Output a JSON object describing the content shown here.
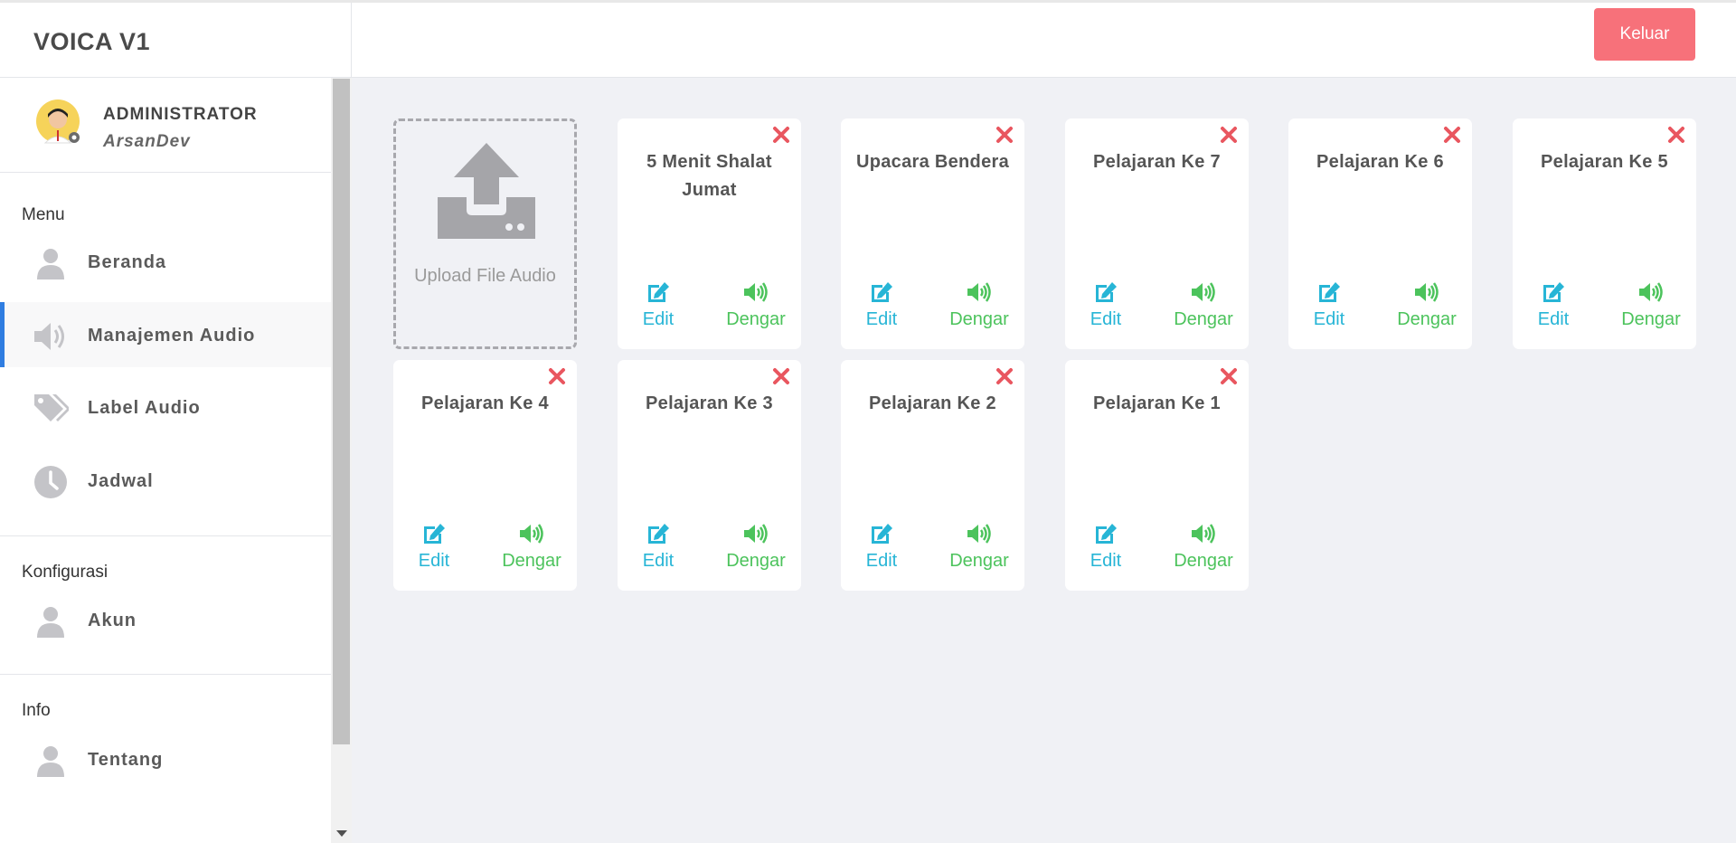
{
  "app": {
    "brand": "VOICA V1",
    "logout_label": "Keluar"
  },
  "profile": {
    "role": "ADMINISTRATOR",
    "username": "ArsanDev"
  },
  "sidebar": {
    "sections": [
      {
        "title": "Menu",
        "items": [
          {
            "label": "Beranda",
            "icon": "user-icon"
          },
          {
            "label": "Manajemen Audio",
            "icon": "volume-icon",
            "active": true
          },
          {
            "label": "Label Audio",
            "icon": "tags-icon"
          },
          {
            "label": "Jadwal",
            "icon": "clock-icon"
          }
        ]
      },
      {
        "title": "Konfigurasi",
        "items": [
          {
            "label": "Akun",
            "icon": "user-icon"
          }
        ]
      },
      {
        "title": "Info",
        "items": [
          {
            "label": "Tentang",
            "icon": "user-icon"
          }
        ]
      }
    ]
  },
  "upload": {
    "label": "Upload File Audio"
  },
  "card_actions": {
    "edit_label": "Edit",
    "listen_label": "Dengar"
  },
  "audio_cards": [
    {
      "title": "5 Menit Shalat Jumat"
    },
    {
      "title": "Upacara Bendera"
    },
    {
      "title": "Pelajaran Ke 7"
    },
    {
      "title": "Pelajaran Ke 6"
    },
    {
      "title": "Pelajaran Ke 5"
    },
    {
      "title": "Pelajaran Ke 4"
    },
    {
      "title": "Pelajaran Ke 3"
    },
    {
      "title": "Pelajaran Ke 2"
    },
    {
      "title": "Pelajaran Ke 1"
    }
  ],
  "colors": {
    "danger": "#f7717a",
    "edit": "#27b5d6",
    "listen": "#4cc35c",
    "close": "#e9565f",
    "active_border": "#2f7de1"
  }
}
